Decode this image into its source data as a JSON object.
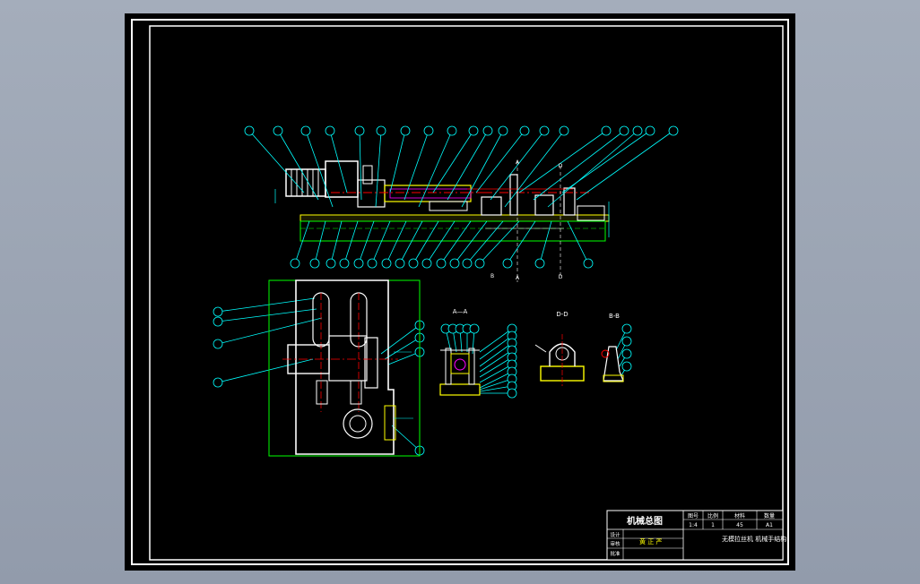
{
  "colors": {
    "background": "#000000",
    "frame": "#ffffff",
    "cyan": "#00ffff",
    "green": "#00ff00",
    "yellow": "#ffff00",
    "red": "#ff0000",
    "magenta": "#ff00ff",
    "page": "#9aa3b2"
  },
  "drawing": {
    "section_labels": {
      "aa": "A—A",
      "dd": "D-D",
      "bb": "B-B",
      "a1": "A",
      "d1": "D",
      "b1": "B",
      "a2": "A",
      "d2": "D"
    }
  },
  "title_block": {
    "drawing_title": "机械总图",
    "header_cells": [
      "图号",
      "比例",
      "材料",
      "数量"
    ],
    "value_cells": [
      "1:4",
      "1",
      "45",
      "A1"
    ],
    "project_name": "无模拉丝机 机械手结构",
    "row_labels": [
      "设计",
      "审核",
      "批准"
    ],
    "designer": "黄 正 严"
  }
}
